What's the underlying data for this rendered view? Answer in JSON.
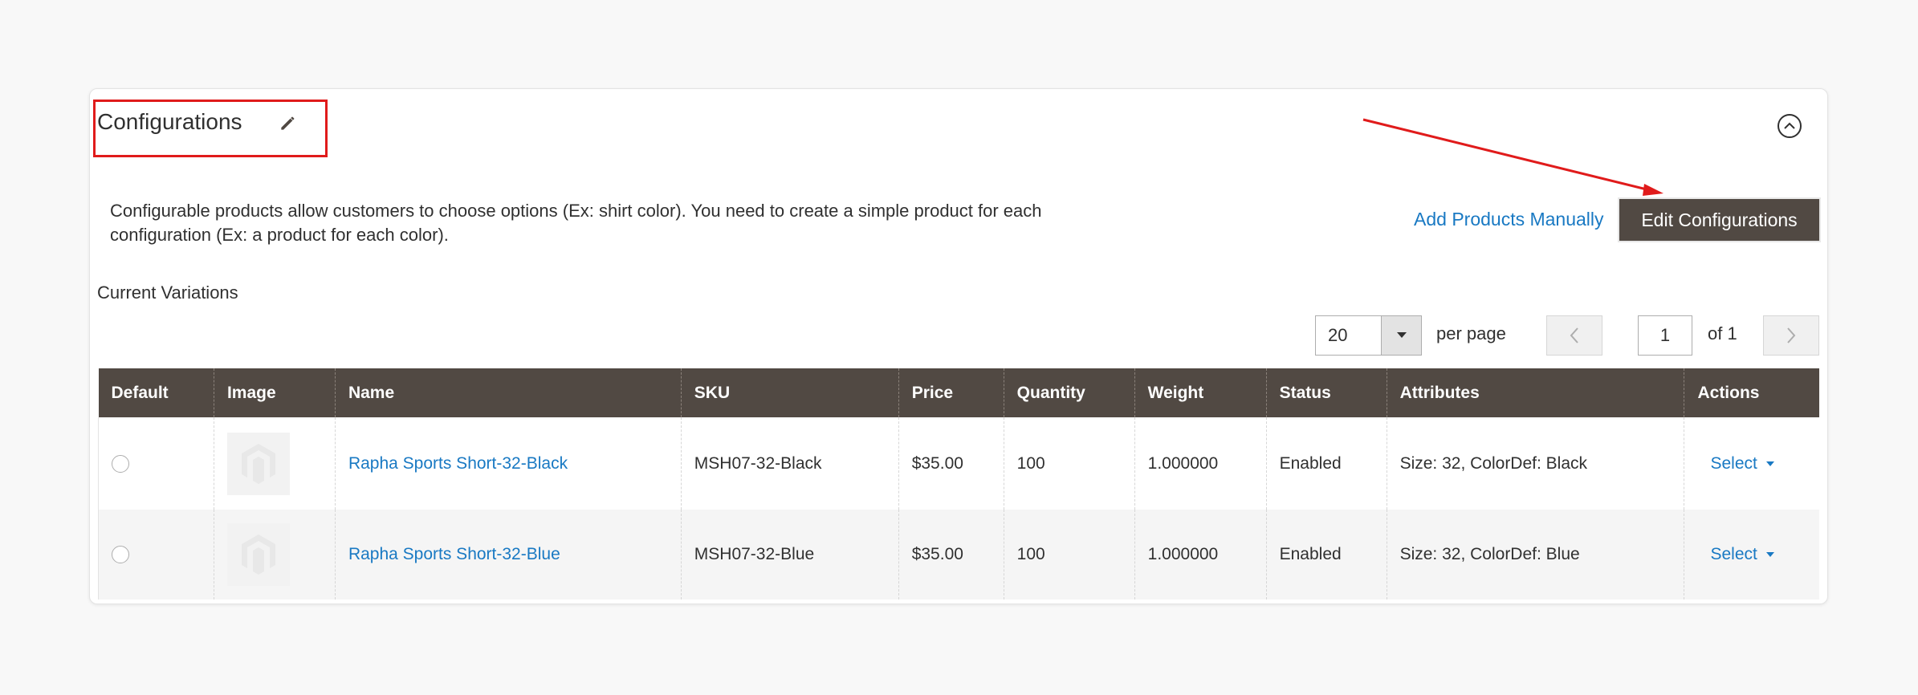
{
  "section": {
    "title": "Configurations",
    "description": "Configurable products allow customers to choose options (Ex: shirt color). You need to create a simple product for each configuration (Ex: a product for each color).",
    "add_manually_label": "Add Products Manually",
    "edit_config_label": "Edit Configurations",
    "current_variations_label": "Current Variations"
  },
  "pager": {
    "per_page_value": "20",
    "per_page_label": "per page",
    "current_page": "1",
    "of_label": "of 1"
  },
  "table": {
    "columns": [
      "Default",
      "Image",
      "Name",
      "SKU",
      "Price",
      "Quantity",
      "Weight",
      "Status",
      "Attributes",
      "Actions"
    ],
    "rows": [
      {
        "name": "Rapha Sports Short-32-Black",
        "sku": "MSH07-32-Black",
        "price": "$35.00",
        "quantity": "100",
        "weight": "1.000000",
        "status": "Enabled",
        "attributes": "Size: 32, ColorDef: Black",
        "action": "Select"
      },
      {
        "name": "Rapha Sports Short-32-Blue",
        "sku": "MSH07-32-Blue",
        "price": "$35.00",
        "quantity": "100",
        "weight": "1.000000",
        "status": "Enabled",
        "attributes": "Size: 32, ColorDef: Blue",
        "action": "Select"
      }
    ]
  },
  "colors": {
    "header_bg": "#514943",
    "link": "#1979c3",
    "annotation_red": "#e01b1b"
  },
  "icons": {
    "edit": "pencil-icon",
    "collapse": "chevron-up-circle-icon",
    "dropdown": "caret-down-icon",
    "prev": "chevron-left-icon",
    "next": "chevron-right-icon",
    "placeholder": "magento-logo-icon"
  }
}
